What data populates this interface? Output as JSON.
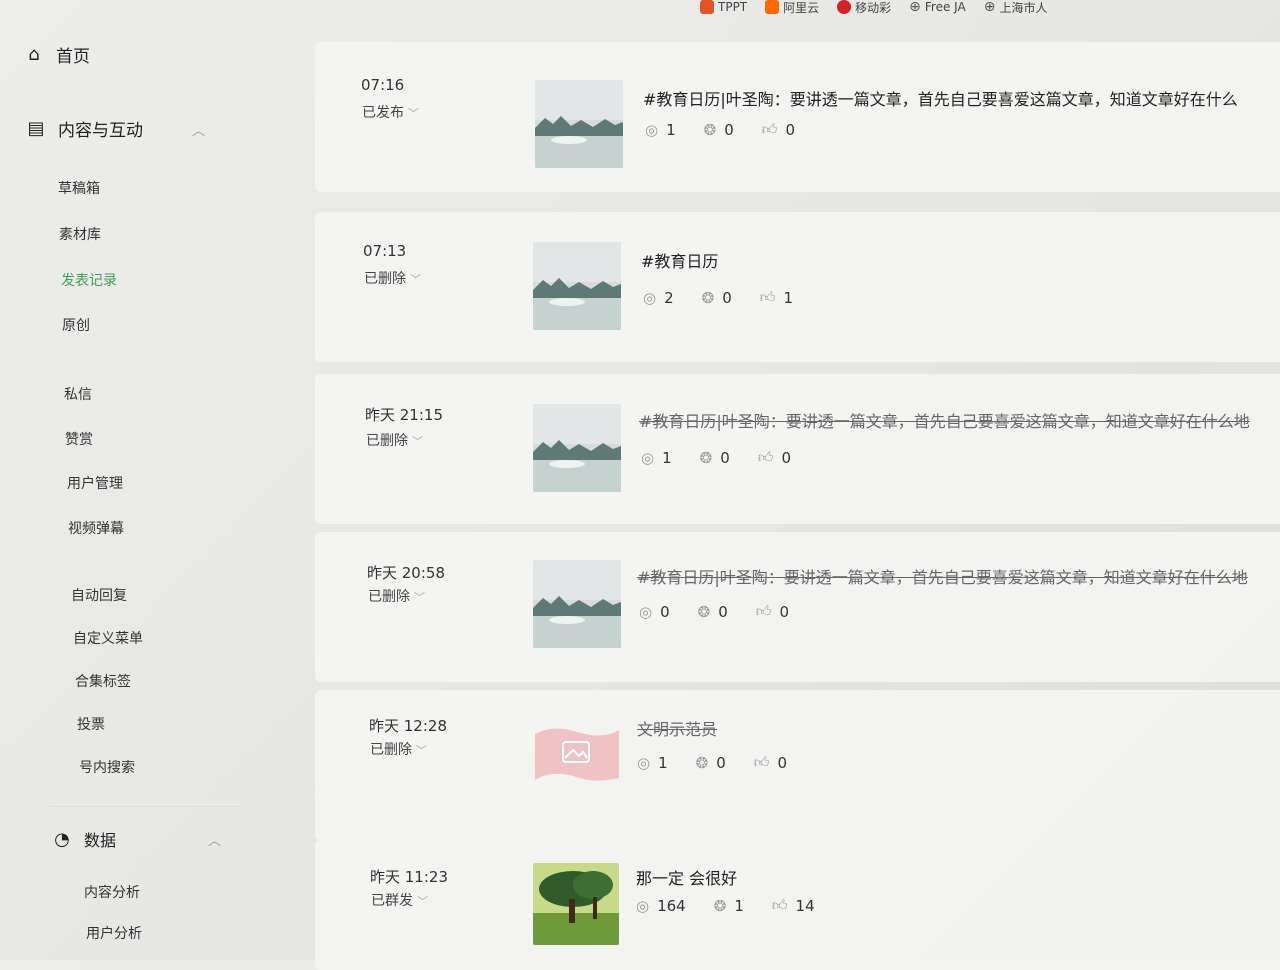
{
  "bookmarks": [
    {
      "label": "TPPT",
      "color": "#e0532b"
    },
    {
      "label": "阿里云",
      "color": "#ff6a00"
    },
    {
      "label": "移动彩",
      "color": "#d2232a"
    },
    {
      "label": "Free JA",
      "color": ""
    },
    {
      "label": "上海市人",
      "color": ""
    }
  ],
  "sidebar": {
    "home": "首页",
    "content_section": "内容与互动",
    "content_items": [
      "草稿箱",
      "素材库",
      "发表记录",
      "原创"
    ],
    "interaction_items": [
      "私信",
      "赞赏",
      "用户管理",
      "视频弹幕"
    ],
    "function_items": [
      "自动回复",
      "自定义菜单",
      "合集标签",
      "投票",
      "号内搜索"
    ],
    "data_section": "数据",
    "data_items": [
      "内容分析",
      "用户分析"
    ],
    "active_color": "#3fa34d"
  },
  "posts": [
    {
      "time": "07:16",
      "status": "已发布",
      "title": "#教育日历|叶圣陶：要讲透一篇文章，首先自己要喜爱这篇文章，知道文章好在什么",
      "views": "1",
      "shares": "0",
      "likes": "0",
      "deleted": false,
      "thumb": "landscape"
    },
    {
      "time": "07:13",
      "status": "已删除",
      "title": "#教育日历",
      "views": "2",
      "shares": "0",
      "likes": "1",
      "deleted": false,
      "thumb": "landscape"
    },
    {
      "time": "昨天 21:15",
      "status": "已删除",
      "title": "#教育日历|叶圣陶：要讲透一篇文章，首先自己要喜爱这篇文章，知道文章好在什么地",
      "views": "1",
      "shares": "0",
      "likes": "0",
      "deleted": true,
      "thumb": "landscape"
    },
    {
      "time": "昨天 20:58",
      "status": "已删除",
      "title": "#教育日历|叶圣陶：要讲透一篇文章，首先自己要喜爱这篇文章，知道文章好在什么地",
      "views": "0",
      "shares": "0",
      "likes": "0",
      "deleted": true,
      "thumb": "landscape"
    },
    {
      "time": "昨天 12:28",
      "status": "已删除",
      "title": "文明示范员",
      "views": "1",
      "shares": "0",
      "likes": "0",
      "deleted": true,
      "thumb": "placeholder"
    },
    {
      "time": "昨天 11:23",
      "status": "已群发",
      "title": "那一定 会很好",
      "views": "164",
      "shares": "1",
      "likes": "14",
      "deleted": false,
      "thumb": "tree"
    }
  ]
}
